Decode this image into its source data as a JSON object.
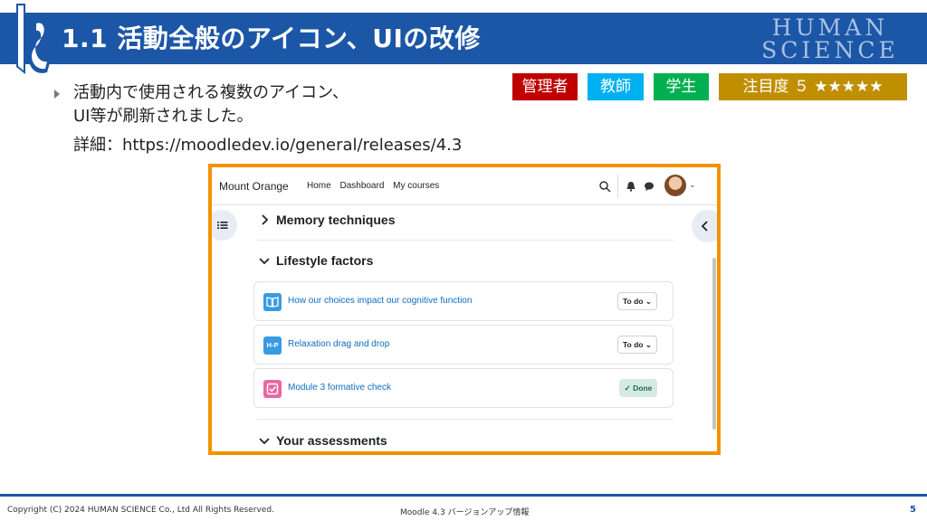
{
  "header": {
    "title": "1.1 活動全般のアイコン、UIの改修",
    "brand_line1": "HUMAN",
    "brand_line2": "SCIENCE"
  },
  "content": {
    "bullet_line1": "活動内で使用される複数のアイコン、",
    "bullet_line2": "UI等が刷新されました。",
    "detail": "詳細：https://moodledev.io/general/releases/4.3"
  },
  "badges": {
    "admin": "管理者",
    "teacher": "教師",
    "student": "学生",
    "attention": "注目度 ５ ★★★★★",
    "colors": {
      "admin": "#c00000",
      "teacher": "#00b0f0",
      "student": "#00b050",
      "attention": "#bf8f00"
    }
  },
  "screenshot": {
    "site_name": "Mount Orange",
    "nav": [
      "Home",
      "Dashboard",
      "My courses"
    ],
    "sections": [
      {
        "title": "Memory techniques",
        "expanded": false
      },
      {
        "title": "Lifestyle factors",
        "expanded": true
      },
      {
        "title": "Your assessments",
        "expanded": true
      }
    ],
    "activities": [
      {
        "name": "How our choices impact our cognitive function",
        "icon": "book-icon",
        "icon_color": "#399be2",
        "status": "To do"
      },
      {
        "name": "Relaxation drag and drop",
        "icon": "h5p-icon",
        "icon_color": "#399be2",
        "icon_text": "H-P",
        "status": "To do"
      },
      {
        "name": "Module 3 formative check",
        "icon": "quiz-icon",
        "icon_color": "#eb66a2",
        "status": "✓ Done"
      }
    ]
  },
  "footer": {
    "copyright": "Copyright (C) 2024 HUMAN SCIENCE Co., Ltd All Rights Reserved.",
    "doc_title": "Moodle 4.3 バージョンアップ情報",
    "page": "5"
  }
}
